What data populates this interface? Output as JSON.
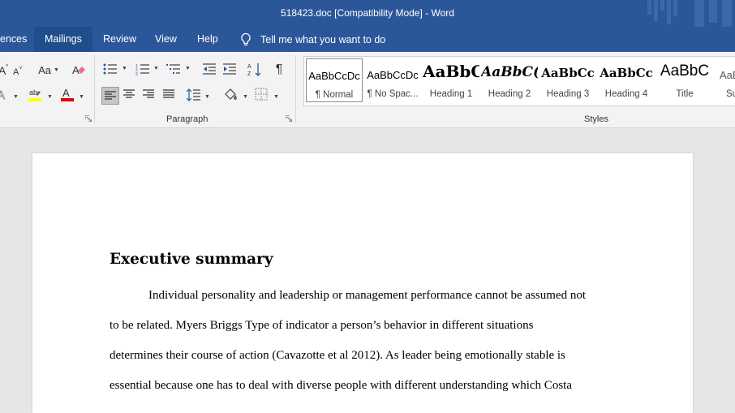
{
  "app": {
    "title": "518423.doc [Compatibility Mode]  -  Word"
  },
  "tabs": [
    {
      "label": "ences"
    },
    {
      "label": "Mailings"
    },
    {
      "label": "Review"
    },
    {
      "label": "View"
    },
    {
      "label": "Help"
    }
  ],
  "tell_me": {
    "label": "Tell me what you want to do"
  },
  "ribbon": {
    "font_group": {
      "change_case_label": "Aa"
    },
    "paragraph_group": {
      "label": "Paragraph"
    },
    "styles_group": {
      "label": "Styles"
    }
  },
  "styles": [
    {
      "preview": "AaBbCcDc",
      "name": "¶ Normal",
      "selected": true
    },
    {
      "preview": "AaBbCcDc",
      "name": "¶ No Spac..."
    },
    {
      "preview": "AaBbC",
      "name": "Heading 1"
    },
    {
      "preview": "AaBbC(",
      "name": "Heading 2"
    },
    {
      "preview": "AaBbCc",
      "name": "Heading 3"
    },
    {
      "preview": "AaBbCc",
      "name": "Heading 4"
    },
    {
      "preview": "AaBbC",
      "name": "Title"
    },
    {
      "preview": "AaBl",
      "name": "Su"
    }
  ],
  "document": {
    "heading": "Executive summary",
    "lines": [
      "Individual personality and leadership or management performance cannot be assumed not",
      "to be related. Myers Briggs Type of indicator a person’s behavior in different situations",
      "determines their course of action (Cavazotte et al 2012). As leader being emotionally stable is",
      "essential because one has to deal with diverse people with different understanding which Costa"
    ]
  },
  "colors": {
    "title_bar": "#2b579a",
    "highlight": "#ffff00",
    "font_color": "#e00000"
  },
  "icons": [
    "font-size-up-icon",
    "font-size-down-icon",
    "change-case-icon",
    "clear-formatting-icon",
    "bullets-icon",
    "numbering-icon",
    "multilevel-list-icon",
    "decrease-indent-icon",
    "increase-indent-icon",
    "sort-icon",
    "show-hide-icon",
    "text-effects-icon",
    "highlight-icon",
    "font-color-icon",
    "align-left-icon",
    "center-icon",
    "align-right-icon",
    "justify-icon",
    "line-spacing-icon",
    "shading-icon",
    "borders-icon",
    "lightbulb-icon"
  ]
}
